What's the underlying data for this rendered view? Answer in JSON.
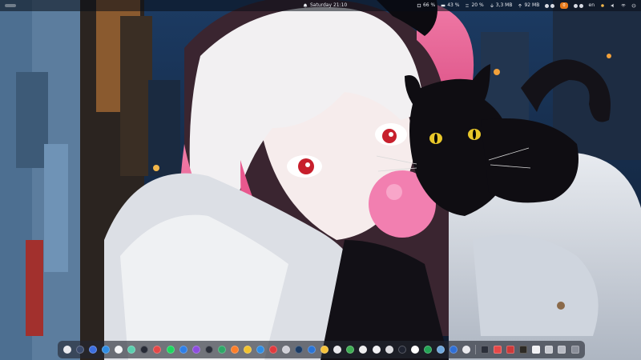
{
  "topbar": {
    "date_time": "Saturday 21:10",
    "cpu": "66 %",
    "ram": "43 %",
    "swap": "20 %",
    "net_down": "3,3 MB",
    "net_up": "92 MB",
    "keyboard": "en",
    "badge": "0"
  },
  "dock": {
    "apps": [
      {
        "name": "app-launcher-icon",
        "color": "#e9e9ee"
      },
      {
        "name": "terminal-icon",
        "color": "#3b4a6b"
      },
      {
        "name": "browser-icon",
        "color": "#3d6fe0"
      },
      {
        "name": "files-icon",
        "color": "#2f8de4"
      },
      {
        "name": "calendar-icon",
        "color": "#f4f4f6"
      },
      {
        "name": "chat-icon",
        "color": "#5ad0ae"
      },
      {
        "name": "settings-icon",
        "color": "#262a36"
      },
      {
        "name": "mail-icon",
        "color": "#e54848"
      },
      {
        "name": "spotify-icon",
        "color": "#1ed760"
      },
      {
        "name": "vpn-icon",
        "color": "#2e7fe8"
      },
      {
        "name": "maps-icon",
        "color": "#8e4de0"
      },
      {
        "name": "code-icon",
        "color": "#2b2f3a"
      },
      {
        "name": "android-icon",
        "color": "#2ea867"
      },
      {
        "name": "firefox-icon",
        "color": "#ff7f2a"
      },
      {
        "name": "chrome-icon",
        "color": "#f2c22e"
      },
      {
        "name": "edge-icon",
        "color": "#2f8de4"
      },
      {
        "name": "vivaldi-icon",
        "color": "#e03a3e"
      },
      {
        "name": "opera-icon",
        "color": "#d0d0d8"
      },
      {
        "name": "steam-icon",
        "color": "#1b3b64"
      },
      {
        "name": "thunderbird-icon",
        "color": "#2a74d6"
      },
      {
        "name": "notes-icon",
        "color": "#f6c23a"
      },
      {
        "name": "clipboard-icon",
        "color": "#e8e8ec"
      },
      {
        "name": "drive-icon",
        "color": "#3fae54"
      },
      {
        "name": "bookmark-icon",
        "color": "#eeeeef"
      },
      {
        "name": "clock-icon",
        "color": "#f1f1f4"
      },
      {
        "name": "reader-icon",
        "color": "#dcdce0"
      },
      {
        "name": "kde-connect-icon",
        "color": "#1f2330"
      },
      {
        "name": "game-icon",
        "color": "#ffffff"
      },
      {
        "name": "torrent-icon",
        "color": "#23a455"
      },
      {
        "name": "screenshot-icon",
        "color": "#6fa8dc"
      },
      {
        "name": "bluetooth-icon",
        "color": "#2f6fd6"
      },
      {
        "name": "notes-alt-icon",
        "color": "#e9e9ee"
      }
    ],
    "tray": [
      {
        "name": "flow-icon",
        "color": "#2b2f3a"
      },
      {
        "name": "speed-icon",
        "color": "#e54848"
      },
      {
        "name": "downloads-icon",
        "color": "#cc3a3a"
      },
      {
        "name": "terminal-alt-icon",
        "color": "#2d2a25"
      },
      {
        "name": "text-editor-icon",
        "color": "#f1f1f4"
      },
      {
        "name": "trash-icon",
        "color": "#c9cbd2"
      },
      {
        "name": "monitor-icon",
        "color": "#b7bac3"
      },
      {
        "name": "show-desktop-icon",
        "color": "#8a8e99"
      }
    ]
  }
}
